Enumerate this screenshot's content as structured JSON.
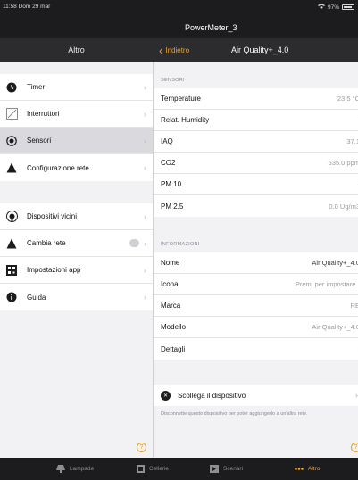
{
  "status": {
    "time_date": "11:58  Dom 29 mar",
    "battery": "97%"
  },
  "device_title": "PowerMeter_3",
  "left_nav": {
    "title": "Altro"
  },
  "right_nav": {
    "back_label": "Indietro",
    "title": "Air Quality+_4.0"
  },
  "menu": {
    "group1": [
      {
        "label": "Timer",
        "icon": "clock-icon"
      },
      {
        "label": "Interruttori",
        "icon": "switch-icon"
      },
      {
        "label": "Sensori",
        "icon": "sensor-icon",
        "selected": true
      },
      {
        "label": "Configurazione rete",
        "icon": "network-icon"
      }
    ],
    "group2": [
      {
        "label": "Dispositivi vicini",
        "icon": "nearby-icon"
      },
      {
        "label": "Cambia rete",
        "icon": "network-icon"
      },
      {
        "label": "Impostazioni app",
        "icon": "qr-icon"
      },
      {
        "label": "Guida",
        "icon": "info-icon"
      }
    ]
  },
  "sensors": {
    "header": "SENSORI",
    "rows": [
      {
        "label": "Temperature",
        "value": "23.5 °C"
      },
      {
        "label": "Relat. Humidity",
        "value": "-"
      },
      {
        "label": "IAQ",
        "value": "37.1"
      },
      {
        "label": "CO2",
        "value": "635.0 ppm"
      },
      {
        "label": "PM 10",
        "value": "-"
      },
      {
        "label": "PM 2.5",
        "value": "0.0 Ug/m3"
      }
    ]
  },
  "info": {
    "header": "INFORMAZIONI",
    "rows": [
      {
        "label": "Nome",
        "value": "Air Quality+_4.0"
      },
      {
        "label": "Icona",
        "value": "Premi per impostare"
      },
      {
        "label": "Marca",
        "value": "RE"
      },
      {
        "label": "Modello",
        "value": "Air Quality+_4.0"
      },
      {
        "label": "Dettagli",
        "value": ""
      }
    ]
  },
  "disconnect": {
    "label": "Scollega il dispositivo",
    "note": "Disconnette questo dispositivo per poter aggiungerlo a un'altra rete."
  },
  "help_label": "?",
  "tabs": [
    {
      "label": "Lampade",
      "icon": "lamp-icon"
    },
    {
      "label": "Cellerie",
      "icon": "cellerie-icon"
    },
    {
      "label": "Scenari",
      "icon": "scene-icon"
    },
    {
      "label": "Altro",
      "icon": "more-icon",
      "active": true
    }
  ],
  "colors": {
    "accent": "#f0a020",
    "bar": "#1c1c1e",
    "nav": "#2c2c2e",
    "selected": "#d9d9de"
  }
}
